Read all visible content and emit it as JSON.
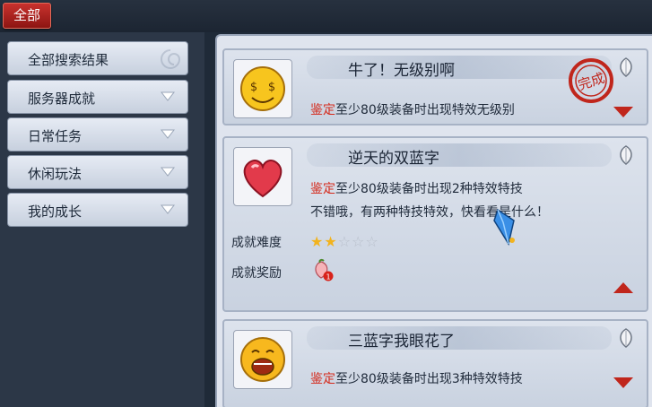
{
  "topbar": {
    "active_tab": "全部"
  },
  "sidebar": {
    "items": [
      {
        "label": "全部搜索结果",
        "expandable": false
      },
      {
        "label": "服务器成就",
        "expandable": true
      },
      {
        "label": "日常任务",
        "expandable": true
      },
      {
        "label": "休闲玩法",
        "expandable": true
      },
      {
        "label": "我的成长",
        "expandable": true
      }
    ]
  },
  "achievements": [
    {
      "title": "牛了！无级别啊",
      "tag": "鉴定",
      "description": "至少80级装备时出现特效无级别",
      "completed_stamp": "完成",
      "expanded": false
    },
    {
      "title": "逆天的双蓝字",
      "tag": "鉴定",
      "description": "至少80级装备时出现2种特效特技",
      "detail": "不错哦，有两种特技特效，快看看是什么！",
      "difficulty_label": "成就难度",
      "difficulty_stars": 2,
      "difficulty_max": 5,
      "reward_label": "成就奖励",
      "reward_count": "1",
      "expanded": true
    },
    {
      "title": "三蓝字我眼花了",
      "tag": "鉴定",
      "description": "至少80级装备时出现3种特效特技",
      "expanded": false
    }
  ],
  "colors": {
    "tag_red": "#d52a1c",
    "tab_red": "#b0221d",
    "star_gold": "#f2b31e"
  }
}
